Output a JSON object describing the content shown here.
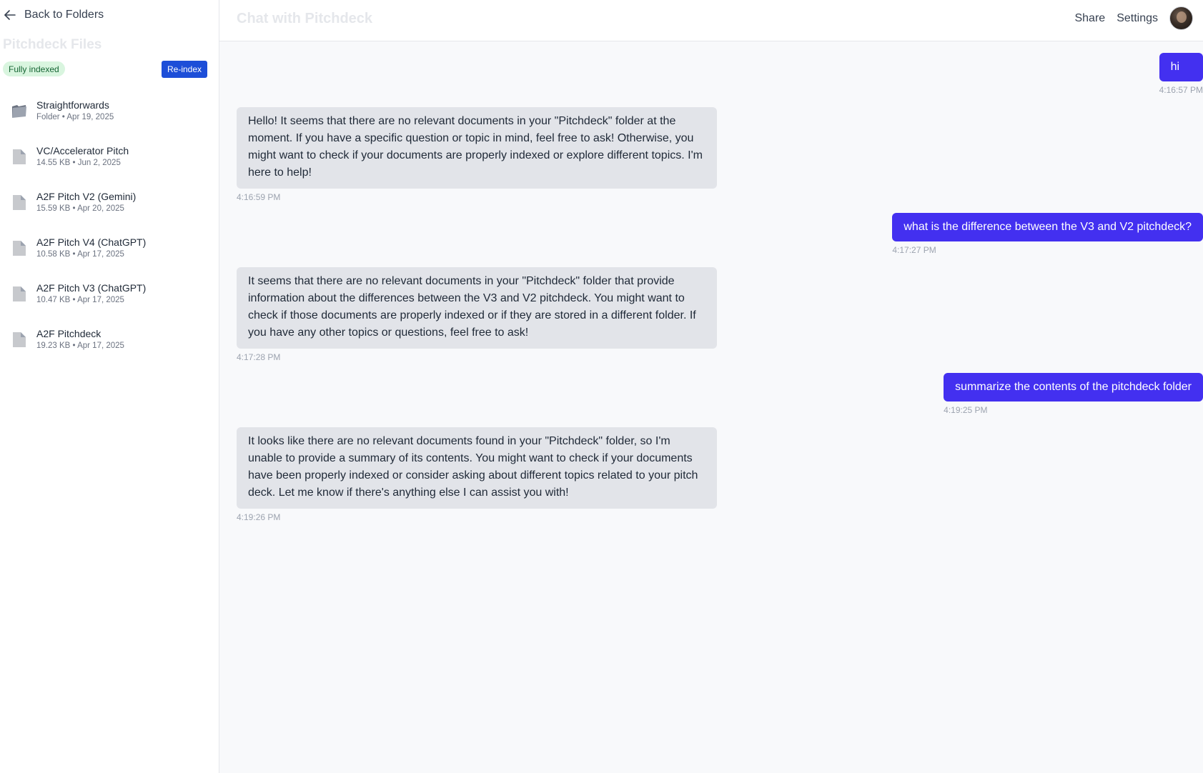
{
  "sidebar": {
    "back_label": "Back to Folders",
    "title": "Pitchdeck Files",
    "status_badge": "Fully indexed",
    "reindex_label": "Re-index",
    "files": [
      {
        "name": "Straightforwards",
        "meta": "Folder • Apr 19, 2025",
        "icon": "folder-icon"
      },
      {
        "name": "VC/Accelerator Pitch",
        "meta": "14.55 KB • Jun 2, 2025",
        "icon": "document-icon"
      },
      {
        "name": "A2F Pitch V2 (Gemini)",
        "meta": "15.59 KB • Apr 20, 2025",
        "icon": "document-icon"
      },
      {
        "name": "A2F Pitch V4 (ChatGPT)",
        "meta": "10.58 KB • Apr 17, 2025",
        "icon": "document-icon"
      },
      {
        "name": "A2F Pitch V3 (ChatGPT)",
        "meta": "10.47 KB • Apr 17, 2025",
        "icon": "document-icon"
      },
      {
        "name": "A2F Pitchdeck",
        "meta": "19.23 KB • Apr 17, 2025",
        "icon": "document-icon"
      }
    ]
  },
  "header": {
    "title": "Chat with Pitchdeck",
    "share_label": "Share",
    "settings_label": "Settings"
  },
  "messages": [
    {
      "role": "user",
      "text": "hi",
      "time": "4:16:57 PM"
    },
    {
      "role": "assistant",
      "text": "Hello! It seems that there are no relevant documents in your \"Pitchdeck\" folder at the moment. If you have a specific question or topic in mind, feel free to ask! Otherwise, you might want to check if your documents are properly indexed or explore different topics. I'm here to help!",
      "time": "4:16:59 PM"
    },
    {
      "role": "user",
      "text": "what is the difference between the V3 and V2 pitchdeck?",
      "time": "4:17:27 PM"
    },
    {
      "role": "assistant",
      "text": "It seems that there are no relevant documents in your \"Pitchdeck\" folder that provide information about the differences between the V3 and V2 pitchdeck. You might want to check if those documents are properly indexed or if they are stored in a different folder. If you have any other topics or questions, feel free to ask!",
      "time": "4:17:28 PM"
    },
    {
      "role": "user",
      "text": "summarize the contents of the pitchdeck folder",
      "time": "4:19:25 PM"
    },
    {
      "role": "assistant",
      "text": "It looks like there are no relevant documents found in your \"Pitchdeck\" folder, so I'm unable to provide a summary of its contents. You might want to check if your documents have been properly indexed or consider asking about different topics related to your pitch deck. Let me know if there's anything else I can assist you with!",
      "time": "4:19:26 PM"
    }
  ],
  "colors": {
    "user_bubble": "#4330f0",
    "assistant_bubble": "#e2e4e9",
    "reindex_button": "#1d4ed8",
    "status_badge_bg": "#d9f5df"
  }
}
